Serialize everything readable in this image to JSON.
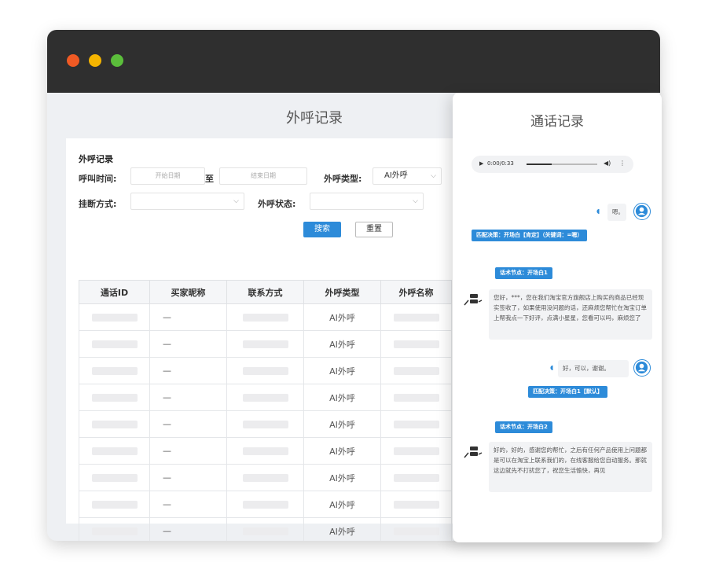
{
  "window": {
    "page_title": "外呼记录"
  },
  "filters": {
    "section_title": "外呼记录",
    "call_time_label": "呼叫时间:",
    "start_placeholder": "开始日期",
    "range_separator": "至",
    "end_placeholder": "结束日期",
    "call_type_label": "外呼类型:",
    "call_type_value": "AI外呼",
    "hangup_label": "挂断方式:",
    "status_label": "外呼状态:",
    "search_button": "搜索",
    "reset_button": "重置"
  },
  "table": {
    "headers": [
      "通话ID",
      "买家昵称",
      "联系方式",
      "外呼类型",
      "外呼名称"
    ],
    "rows": [
      {
        "nickname": "—",
        "type": "AI外呼"
      },
      {
        "nickname": "—",
        "type": "AI外呼"
      },
      {
        "nickname": "—",
        "type": "AI外呼"
      },
      {
        "nickname": "—",
        "type": "AI外呼"
      },
      {
        "nickname": "—",
        "type": "AI外呼"
      },
      {
        "nickname": "—",
        "type": "AI外呼"
      },
      {
        "nickname": "—",
        "type": "AI外呼"
      },
      {
        "nickname": "—",
        "type": "AI外呼"
      },
      {
        "nickname": "—",
        "type": "AI外呼"
      }
    ]
  },
  "call_record": {
    "title": "通话记录",
    "audio_time": "0:00/0:33",
    "messages": {
      "user1_text": "嗯。",
      "match1_tag": "匹配决策：开场白【肯定】（关键词：=嗯）",
      "node1_tag": "话术节点：开场白1",
      "bot1_text": "您好，***，您在我们淘宝官方旗舰店上购买的商品已经现实签收了，如果使用没问题的话，还麻烦您帮忙在淘宝订单上帮我点一下好评，点满小星星，您看可以吗，麻烦您了",
      "user2_text": "好，可以，谢谢。",
      "match2_tag": "匹配决策：开场白1【默认】",
      "node2_tag": "话术节点：开场白2",
      "bot2_text": "好的，好的，感谢您的帮忙，之后有任何产品使用上问题都是可以在淘宝上联系我们的，在线客服给您自动服务。那就这边就先不打扰您了，祝您生活愉快，再见"
    }
  }
}
